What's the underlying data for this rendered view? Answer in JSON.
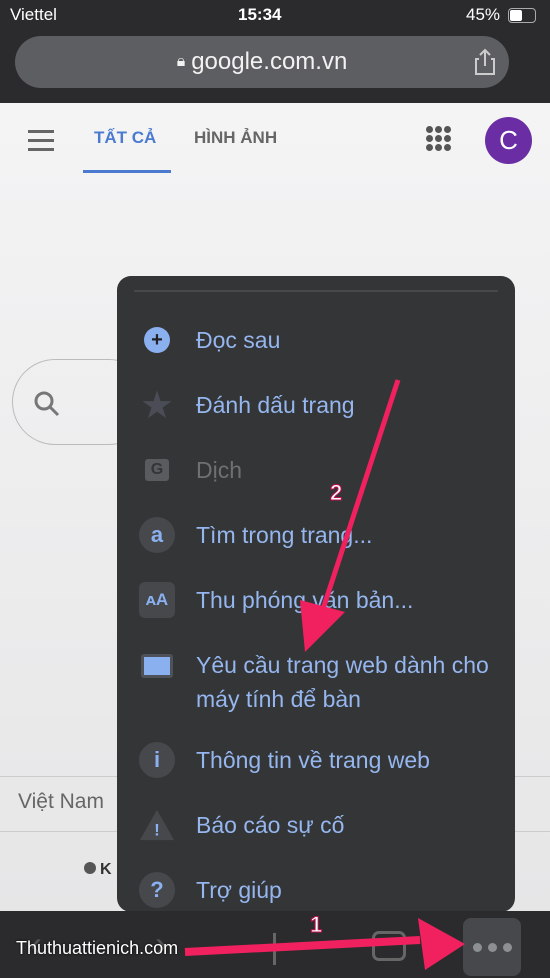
{
  "status": {
    "carrier": "Viettel",
    "time": "15:34",
    "battery": "45%"
  },
  "url": "google.com.vn",
  "page": {
    "tabs": [
      "TẤT CẢ",
      "HÌNH ẢNH"
    ],
    "avatar": "C",
    "region": "Việt Nam",
    "footer_partial": "K"
  },
  "menu": {
    "items": [
      {
        "label": "Đọc sau",
        "icon": "read-later-icon",
        "disabled": false
      },
      {
        "label": "Đánh dấu trang",
        "icon": "bookmark-star-icon",
        "disabled": false
      },
      {
        "label": "Dịch",
        "icon": "translate-icon",
        "disabled": true
      },
      {
        "label": "Tìm trong trang...",
        "icon": "find-in-page-icon",
        "disabled": false
      },
      {
        "label": "Thu phóng văn bản...",
        "icon": "text-zoom-icon",
        "disabled": false
      },
      {
        "label": "Yêu cầu trang web dành cho máy tính để bàn",
        "icon": "desktop-icon",
        "disabled": false
      },
      {
        "label": "Thông tin về trang web",
        "icon": "info-icon",
        "disabled": false
      },
      {
        "label": "Báo cáo sự cố",
        "icon": "warning-icon",
        "disabled": false
      },
      {
        "label": "Trợ giúp",
        "icon": "help-icon",
        "disabled": false
      }
    ],
    "accent": "#95b6ee"
  },
  "annotations": {
    "step1": "1",
    "step2": "2",
    "arrow_color": "#f0215e",
    "watermark": "Thuthuattienich.com"
  }
}
